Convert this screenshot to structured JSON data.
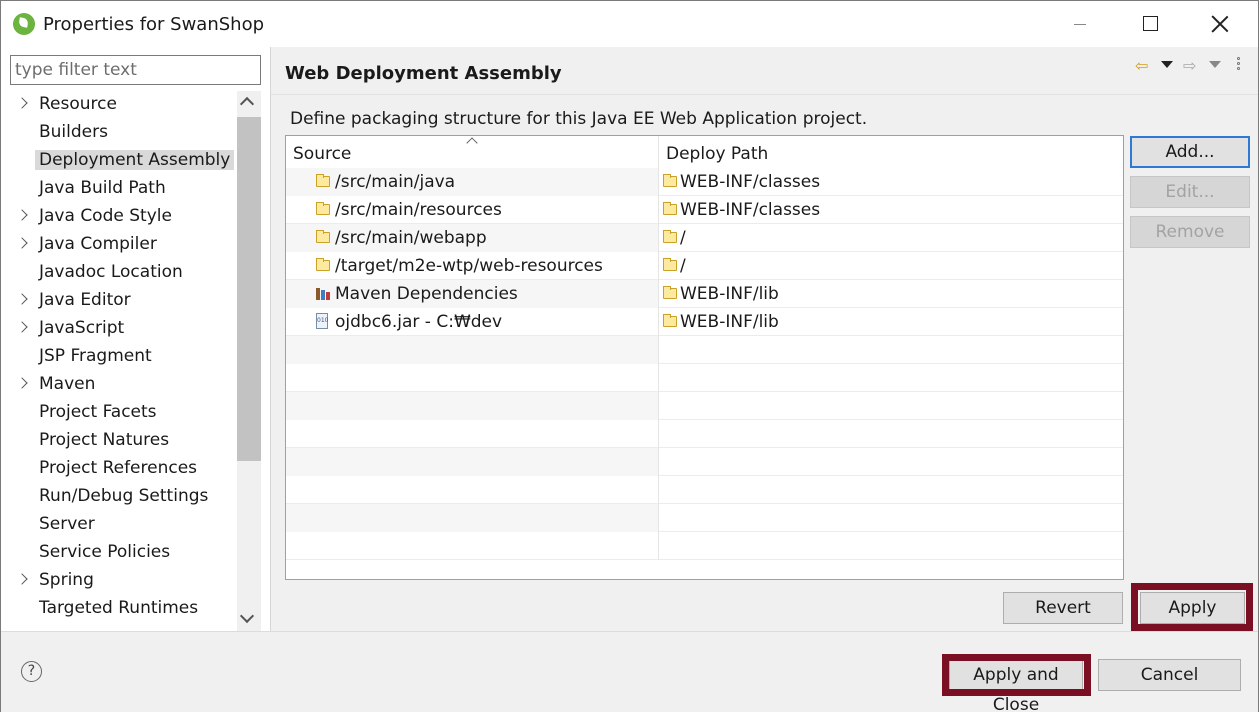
{
  "window": {
    "title": "Properties for SwanShop"
  },
  "filter": {
    "placeholder": "type filter text"
  },
  "nav": {
    "items": [
      {
        "label": "Resource",
        "expandable": true
      },
      {
        "label": "Builders",
        "expandable": false
      },
      {
        "label": "Deployment Assembly",
        "expandable": false,
        "selected": true
      },
      {
        "label": "Java Build Path",
        "expandable": false
      },
      {
        "label": "Java Code Style",
        "expandable": true
      },
      {
        "label": "Java Compiler",
        "expandable": true
      },
      {
        "label": "Javadoc Location",
        "expandable": false
      },
      {
        "label": "Java Editor",
        "expandable": true
      },
      {
        "label": "JavaScript",
        "expandable": true
      },
      {
        "label": "JSP Fragment",
        "expandable": false
      },
      {
        "label": "Maven",
        "expandable": true
      },
      {
        "label": "Project Facets",
        "expandable": false
      },
      {
        "label": "Project Natures",
        "expandable": false
      },
      {
        "label": "Project References",
        "expandable": false
      },
      {
        "label": "Run/Debug Settings",
        "expandable": false
      },
      {
        "label": "Server",
        "expandable": false
      },
      {
        "label": "Service Policies",
        "expandable": false
      },
      {
        "label": "Spring",
        "expandable": true
      },
      {
        "label": "Targeted Runtimes",
        "expandable": false
      }
    ]
  },
  "page": {
    "title": "Web Deployment Assembly",
    "description": "Define packaging structure for this Java EE Web Application project."
  },
  "table": {
    "columns": {
      "source": "Source",
      "deploy": "Deploy Path"
    },
    "rows": [
      {
        "source": "/src/main/java",
        "source_icon": "folder-icon",
        "deploy": "WEB-INF/classes"
      },
      {
        "source": "/src/main/resources",
        "source_icon": "folder-icon",
        "deploy": "WEB-INF/classes"
      },
      {
        "source": "/src/main/webapp",
        "source_icon": "folder-icon",
        "deploy": "/"
      },
      {
        "source": "/target/m2e-wtp/web-resources",
        "source_icon": "folder-icon",
        "deploy": "/"
      },
      {
        "source": "Maven Dependencies",
        "source_icon": "library-icon",
        "deploy": "WEB-INF/lib"
      },
      {
        "source": "ojdbc6.jar - C:₩dev",
        "source_icon": "jar-icon",
        "deploy": "WEB-INF/lib"
      }
    ]
  },
  "buttons": {
    "add": "Add...",
    "edit": "Edit...",
    "remove": "Remove",
    "revert": "Revert",
    "apply": "Apply",
    "apply_and_close": "Apply and Close",
    "cancel": "Cancel"
  },
  "icons": {
    "jar_label": "010"
  },
  "colors": {
    "highlight": "#7a0f24",
    "focus": "#2f78d4",
    "spring": "#6db33f"
  }
}
